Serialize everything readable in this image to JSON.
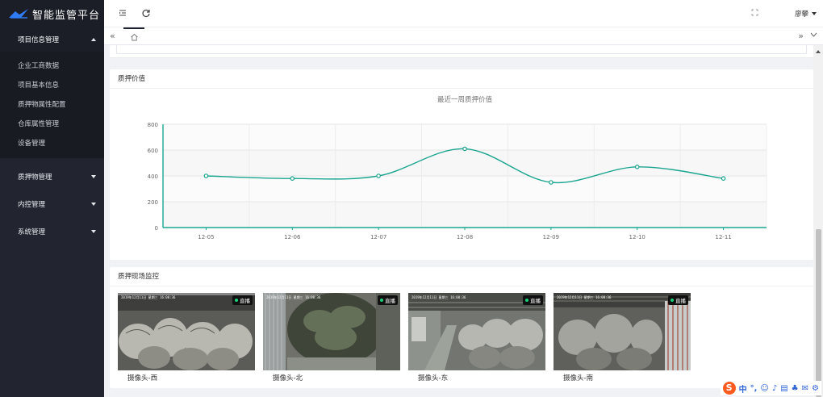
{
  "app": {
    "title": "智能监管平台"
  },
  "sidebar": {
    "open_group": {
      "label": "项目信息管理",
      "items": [
        {
          "label": "企业工商数据"
        },
        {
          "label": "项目基本信息"
        },
        {
          "label": "质押物属性配置"
        },
        {
          "label": "仓库属性管理"
        },
        {
          "label": "设备管理"
        }
      ]
    },
    "groups": [
      {
        "label": "质押物管理"
      },
      {
        "label": "内控管理"
      },
      {
        "label": "系统管理"
      }
    ]
  },
  "header": {
    "menu_icon": "menu-fold-icon",
    "refresh_icon": "refresh-icon",
    "user_name": "廖攀",
    "tabs": [
      {
        "icon": "home-icon"
      }
    ]
  },
  "value_panel": {
    "title": "质押价值"
  },
  "chart_data": {
    "type": "line",
    "title": "最近一周质押价值",
    "categories": [
      "12-05",
      "12-06",
      "12-07",
      "12-08",
      "12-09",
      "12-10",
      "12-11"
    ],
    "series": [
      {
        "values": [
          400,
          380,
          400,
          610,
          350,
          470,
          380
        ]
      }
    ],
    "ylim": [
      0,
      800
    ],
    "yticks": [
      0,
      200,
      400,
      600,
      800
    ],
    "color": "#1aa590",
    "grid": true
  },
  "monitor_panel": {
    "title": "质押现场监控",
    "live_label": "直播",
    "cameras": [
      {
        "label": "摄像头-西",
        "timestamp": "2019年12月11日 星期三 16:00:36"
      },
      {
        "label": "摄像头-北",
        "timestamp": "2019年12月11日 星期三 16:00:36"
      },
      {
        "label": "摄像头-东",
        "timestamp": "2019年12月11日 星期三 16:00:36"
      },
      {
        "label": "摄像头-南",
        "timestamp": "2019年12月11日 星期三 16:00:36"
      }
    ]
  },
  "ime": {
    "logo": "S",
    "items": [
      "中",
      "°,",
      "☺",
      "♪",
      "▤",
      "♣",
      "✉",
      "⚙"
    ]
  }
}
